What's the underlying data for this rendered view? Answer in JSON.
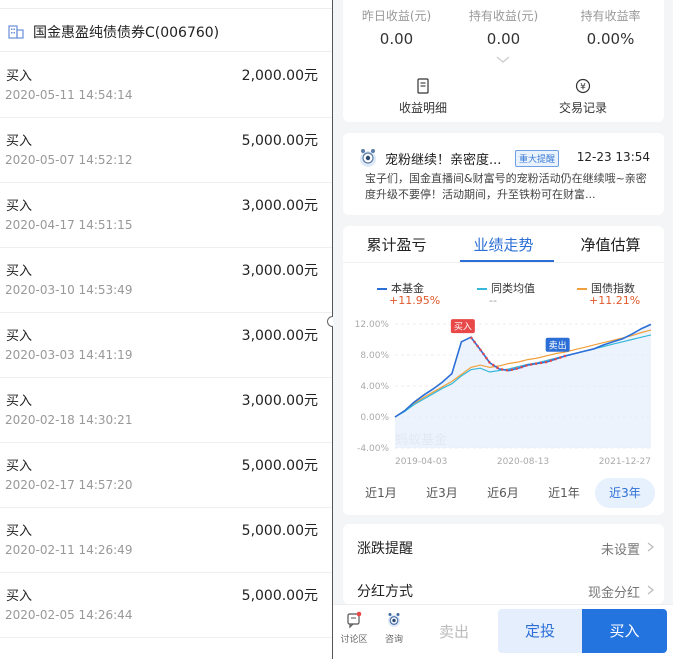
{
  "left_panel": {
    "fund_name": "国金惠盈纯债债券C(006760)",
    "transactions": [
      {
        "type": "买入",
        "time": "2020-05-11 14:54:14",
        "amount": "2,000.00元"
      },
      {
        "type": "买入",
        "time": "2020-05-07 14:52:12",
        "amount": "5,000.00元"
      },
      {
        "type": "买入",
        "time": "2020-04-17 14:51:15",
        "amount": "3,000.00元"
      },
      {
        "type": "买入",
        "time": "2020-03-10 14:53:49",
        "amount": "3,000.00元"
      },
      {
        "type": "买入",
        "time": "2020-03-03 14:41:19",
        "amount": "3,000.00元"
      },
      {
        "type": "买入",
        "time": "2020-02-18 14:30:21",
        "amount": "3,000.00元"
      },
      {
        "type": "买入",
        "time": "2020-02-17 14:57:20",
        "amount": "5,000.00元"
      },
      {
        "type": "买入",
        "time": "2020-02-11 14:26:49",
        "amount": "5,000.00元"
      },
      {
        "type": "买入",
        "time": "2020-02-05 14:26:44",
        "amount": "5,000.00元"
      }
    ]
  },
  "income": {
    "yesterday_label": "昨日收益(元)",
    "yesterday_value": "0.00",
    "holding_label": "持有收益(元)",
    "holding_value": "0.00",
    "rate_label": "持有收益率",
    "rate_value": "0.00%",
    "detail_label": "收益明细",
    "records_label": "交易记录"
  },
  "notice": {
    "title": "宠粉继续！亲密度...",
    "badge": "重大提醒",
    "time": "12-23 13:54",
    "body": "宝子们，国金直播间&财富号的宠粉活动仍在继续哦~亲密度升级不要停！活动期间，升至铁粉可在财富..."
  },
  "chart_tabs": [
    "累计盈亏",
    "业绩走势",
    "净值估算"
  ],
  "chart_data": {
    "type": "line",
    "watermark": "蚂蚁基金",
    "legend": [
      {
        "name": "本基金",
        "value": "+11.95%",
        "color": "#2b6fd6",
        "value_color": "#e0592a"
      },
      {
        "name": "同类均值",
        "value": "--",
        "color": "#35b8d9",
        "value_color": "#999999"
      },
      {
        "name": "国债指数",
        "value": "+11.21%",
        "color": "#f0a03c",
        "value_color": "#e0592a"
      }
    ],
    "y_ticks": [
      "12.00%",
      "8.00%",
      "4.00%",
      "0.00%",
      "-4.00%"
    ],
    "x_ticks": [
      "2019-04-03",
      "2020-08-13",
      "2021-12-27"
    ],
    "ylim": [
      -4,
      12
    ],
    "markers": [
      {
        "label": "买入",
        "color": "#e84848"
      },
      {
        "label": "卖出",
        "color": "#2b6fd6"
      }
    ],
    "series": [
      {
        "name": "本基金",
        "values": [
          0.0,
          0.8,
          1.9,
          2.8,
          3.6,
          4.5,
          5.6,
          9.7,
          10.3,
          8.7,
          7.0,
          6.2,
          6.0,
          6.3,
          6.7,
          6.9,
          7.1,
          7.5,
          7.9,
          8.2,
          8.5,
          8.8,
          9.3,
          9.7,
          10.1,
          10.7,
          11.4,
          11.95
        ]
      },
      {
        "name": "同类均值",
        "values": [
          0.0,
          0.7,
          1.6,
          2.3,
          3.0,
          3.7,
          4.3,
          5.3,
          6.1,
          6.3,
          5.8,
          6.0,
          6.2,
          6.5,
          6.8,
          7.0,
          7.3,
          7.6,
          7.9,
          8.2,
          8.5,
          8.8,
          9.1,
          9.4,
          9.7,
          10.0,
          10.3,
          10.6
        ]
      },
      {
        "name": "国债指数",
        "values": [
          0.0,
          0.8,
          1.7,
          2.5,
          3.2,
          3.9,
          4.6,
          5.5,
          6.4,
          6.7,
          6.4,
          6.6,
          6.9,
          7.1,
          7.4,
          7.6,
          7.9,
          8.2,
          8.4,
          8.7,
          9.0,
          9.3,
          9.6,
          9.9,
          10.2,
          10.5,
          10.9,
          11.21
        ]
      }
    ],
    "buy_index": 8,
    "sell_index": 18
  },
  "periods": [
    "近1月",
    "近3月",
    "近6月",
    "近1年",
    "近3年"
  ],
  "active_period": 4,
  "settings": [
    {
      "label": "涨跌提醒",
      "value": "未设置"
    },
    {
      "label": "分红方式",
      "value": "现金分红"
    }
  ],
  "bottom": {
    "discuss_label": "讨论区",
    "consult_label": "咨询",
    "sell_label": "卖出",
    "dingtou_label": "定投",
    "buy_label": "买入"
  }
}
